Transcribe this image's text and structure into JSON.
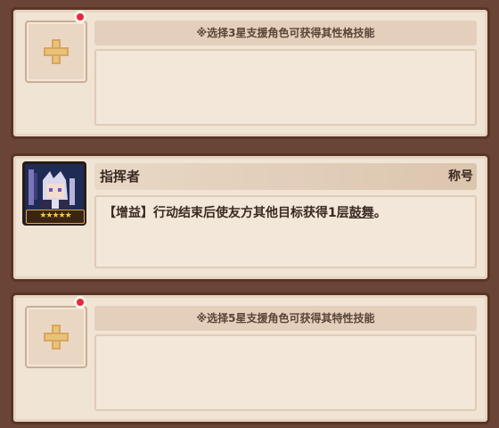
{
  "slots": [
    {
      "hint": "※选择3星支援角色可获得其性格技能"
    },
    {
      "hint": "※选择5星支援角色可获得其特性技能"
    }
  ],
  "character": {
    "name": "指挥者",
    "title": "称号",
    "stars": "★★★★★",
    "description_prefix": "【增益】行动结束后使友方其他目标获得1层",
    "keyword": "鼓舞",
    "description_suffix": "。",
    "portrait_icon": "silver-haired-girl-portrait"
  },
  "colors": {
    "background": "#6a4434",
    "panel": "#f0e4d4",
    "notification": "#e8283c",
    "plus": "#e9c27a"
  }
}
